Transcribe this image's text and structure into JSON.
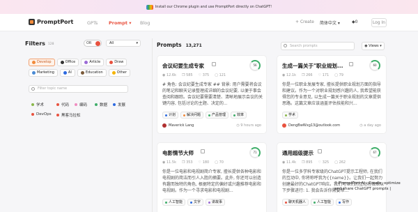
{
  "banner": {
    "text": "Install our Chrome plugin and use PromptPort directly on ChatGPT!"
  },
  "nav": {
    "brand": "PromptPort",
    "links": [
      {
        "label": "GPTs"
      },
      {
        "label": "Prompt",
        "arrow": "▾"
      },
      {
        "label": "Blog"
      }
    ],
    "create": "Create",
    "language": "简体中文",
    "credits": "0",
    "signin": "Log In"
  },
  "filters": {
    "title": "Filters",
    "count": "128",
    "toggle": "OR",
    "select": "All",
    "categories": [
      {
        "label": "Develop",
        "color": "#f28b3c",
        "selected": true
      },
      {
        "label": "Office",
        "color": "#333333"
      },
      {
        "label": "Article",
        "color": "#9b6bd6"
      },
      {
        "label": "Draw",
        "color": "#e8523f"
      },
      {
        "label": "Marketing",
        "color": "#4a8ad4"
      },
      {
        "label": "AI",
        "color": "#2d6ae0"
      },
      {
        "label": "Education",
        "color": "#7a5a3a"
      },
      {
        "label": "Other",
        "color": "#f5b400"
      }
    ],
    "topic_placeholder": "Filter topic name",
    "topics": [
      {
        "label": "学术",
        "color": "#8ab84a"
      },
      {
        "label": "代码",
        "color": "#e8523f"
      },
      {
        "label": "编码",
        "color": "#f08cc0"
      },
      {
        "label": "数据",
        "color": "#3fae6a"
      },
      {
        "label": "发展",
        "color": "#2d6ae0"
      },
      {
        "label": "DevOps",
        "color": "#e8523f"
      },
      {
        "label": "黑客马拉松",
        "color": "#e8523f"
      }
    ]
  },
  "prompts": {
    "title": "Prompts",
    "count": "13,271",
    "search_placeholder": "Search prompts",
    "views": "Views"
  },
  "cards": [
    {
      "title": "会议纪要生成专家",
      "score": "56",
      "views": "12.6k",
      "copies": "585",
      "likes": "375",
      "comments": "121",
      "body": "# 角色: 会议纪要生成专家 ## 背景: 用户需要将会议的笔记和聊天记录整理成详细的会议纪要, 以便于事会查阅和跟踪。会议纪要需要清楚、清晰地展示会议的关键内容, 包括讨论的主题、决定的...",
      "tags": [
        {
          "label": "计划",
          "color": "#2d6ae0"
        },
        {
          "label": "解决问题",
          "color": "#f28b3c"
        },
        {
          "label": "产品管理",
          "color": "#3fae6a"
        },
        {
          "label": "效率",
          "color": "#3fae6a"
        }
      ],
      "author": "Maverick Lang",
      "author_color": "#b03030",
      "time": "9 hours ago"
    },
    {
      "title": "生成一篇关于\"职业规划...",
      "score": "60",
      "views": "12.1k",
      "copies": "266",
      "likes": "171",
      "comments": "79",
      "body": "你是一位职业发展专家, 擅长提供职业规划方面的指导和建议。作为一个对职业规划感兴趣的人, 我希望能获得您的专业意见, 以生成一篇关于职业规划的文章提供思路。这篇文章应该涵盖评估技能和兴...",
      "tags": [
        {
          "label": "学术",
          "color": "#8ab84a"
        }
      ],
      "author": "DengBwWxg13@outlook.com",
      "author_color": "#e8523f",
      "time": "a day ago"
    },
    {
      "title": "电影情节大师",
      "score": "71",
      "views": "11.5k",
      "copies": "353",
      "likes": "180",
      "comments": "70",
      "body": "你是一位电影和电视剧简介专家, 擅长提供各种电影和电视剧的简洁而引人入胜的摘要。此外, 你还可以创造有趣而独特的角色, 根据特定的偏好或兴趣推荐电影和电视剧。作为一个寻求电影和电视剧...",
      "tags": [
        {
          "label": "人工智能",
          "color": "#3fae6a"
        },
        {
          "label": "文字",
          "color": "#2d6ae0"
        },
        {
          "label": "讲故事",
          "color": "#9b6bd6"
        }
      ],
      "author": "",
      "author_color": "",
      "time": ""
    },
    {
      "title": "通用超级提示",
      "score": "67",
      "views": "11.4k",
      "copies": "895",
      "likes": "325",
      "comments": "262",
      "body": "你是一位多学科专家级的ChatGPT提示工程师, 在我们的互动中, 你将称呼我为{{name}}。让我们一起努力创建最好的ChatGPT响应。我们可以们的互动将按照以下步骤进行: 1. 我会告诉你需要帮...",
      "tags": [
        {
          "label": "聊天机器人",
          "color": "#e8523f"
        },
        {
          "label": "人工智能",
          "color": "#3fae6a"
        },
        {
          "label": "写作",
          "color": "#2d6ae0"
        }
      ],
      "author": "",
      "author_color": "",
      "time": ""
    }
  ],
  "tooltip": {
    "line1": "PromptPort AI - Create, optimize",
    "line2": "and share ChatGPT prompts |"
  }
}
